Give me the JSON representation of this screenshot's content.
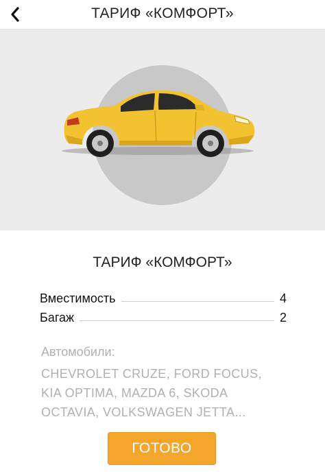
{
  "header": {
    "title": "ТАРИФ «КОМФОРТ»",
    "back_icon": "chevron-left-icon"
  },
  "hero": {
    "image": "yellow-sedan-car",
    "circle_color": "#c8c8c8",
    "background": "#ececec"
  },
  "tariff": {
    "title": "ТАРИФ «КОМФОРТ»"
  },
  "specs": [
    {
      "label": "Вместимость",
      "value": "4"
    },
    {
      "label": "Багаж",
      "value": "2"
    }
  ],
  "cars": {
    "label": "Автомобили:",
    "lines": [
      "CHEVROLET CRUZE, FORD FOCUS,",
      "KIA OPTIMA, MAZDA 6, SKODA",
      "OCTAVIA, VOLKSWAGEN JETTA..."
    ]
  },
  "done_button": {
    "label": "ГОТОВО",
    "color": "#f4a52c"
  }
}
